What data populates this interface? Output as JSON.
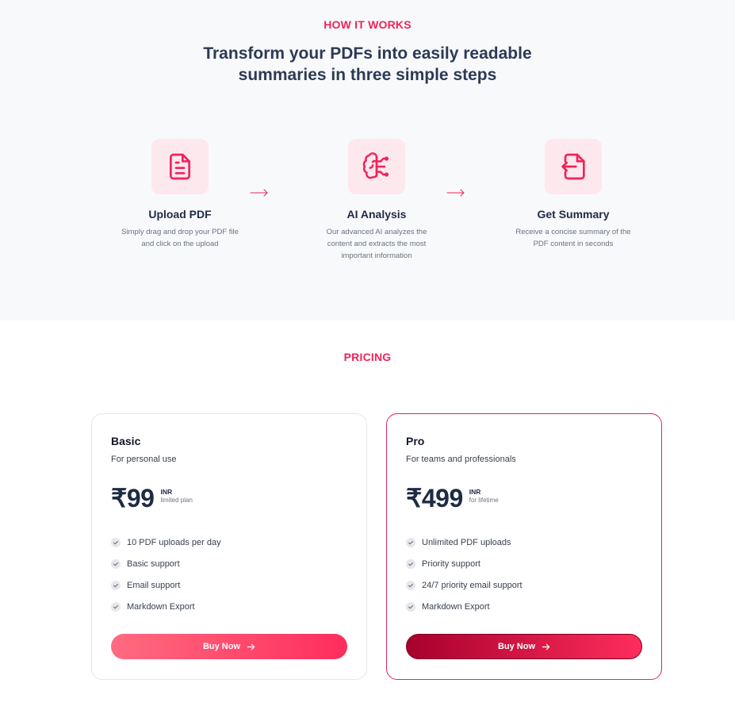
{
  "how": {
    "eyebrow": "HOW IT WORKS",
    "headline_line1": "Transform your PDFs into easily readable",
    "headline_line2": "summaries in three simple steps",
    "steps": [
      {
        "title": "Upload PDF",
        "text": "Simply drag and drop your PDF file and click on the upload",
        "icon": "document-icon"
      },
      {
        "title": "AI Analysis",
        "text": "Our advanced AI analyzes the content and extracts the most important information",
        "icon": "brain-icon"
      },
      {
        "title": "Get Summary",
        "text": "Receive a concise summary of the PDF content in seconds",
        "icon": "file-output-icon"
      }
    ]
  },
  "pricing": {
    "eyebrow": "PRICING",
    "plans": [
      {
        "name": "Basic",
        "desc": "For personal use",
        "price": "₹99",
        "currency": "INR",
        "note": "limited plan",
        "features": [
          "10 PDF uploads per day",
          "Basic support",
          "Email support",
          "Markdown Export"
        ],
        "cta": "Buy Now"
      },
      {
        "name": "Pro",
        "desc": "For teams and professionals",
        "price": "₹499",
        "currency": "INR",
        "note": "for lifetime",
        "features": [
          "Unlimited PDF uploads",
          "Priority support",
          "24/7 priority email support",
          "Markdown Export"
        ],
        "cta": "Buy Now"
      }
    ]
  },
  "colors": {
    "accent": "#f0245a",
    "icon_bg": "#fde8ee",
    "heading": "#2d3a55",
    "pro_button_start": "#a8002d"
  }
}
